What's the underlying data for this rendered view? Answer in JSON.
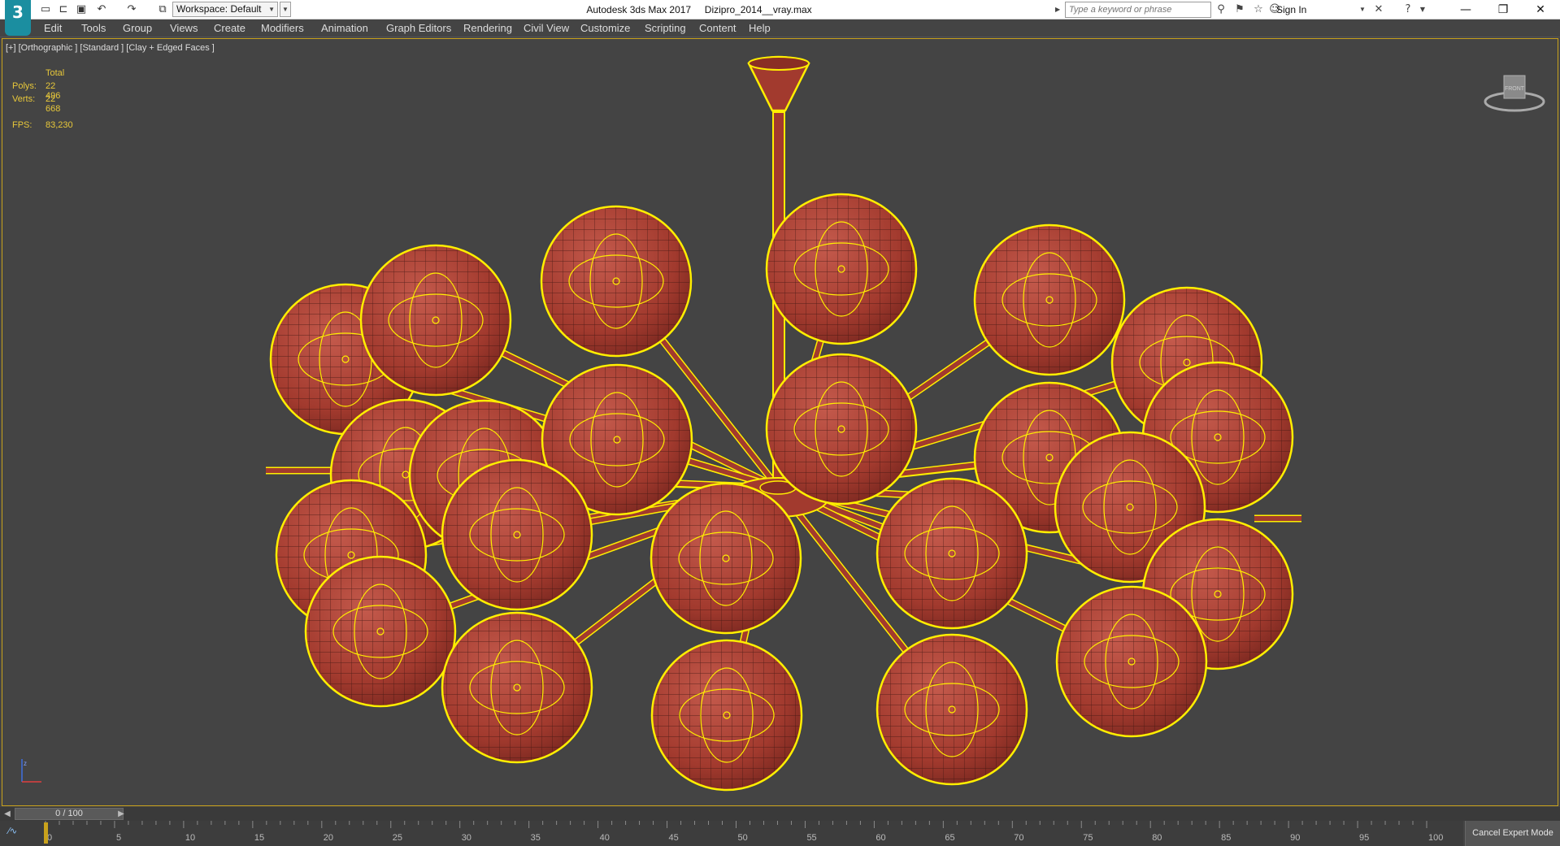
{
  "window": {
    "title": "Autodesk 3ds Max 2017     Dizipro_2014__vray.max",
    "app_logo": "3"
  },
  "quick_access": {
    "icons": [
      "new-file-icon",
      "open-file-icon",
      "save-icon",
      "undo-icon",
      "redo-icon",
      "project-folder-icon"
    ],
    "workspace_label": "Workspace: Default"
  },
  "search": {
    "placeholder": "Type a keyword or phrase"
  },
  "signin": {
    "label": "Sign In"
  },
  "menu": {
    "items": [
      "Edit",
      "Tools",
      "Group",
      "Views",
      "Create",
      "Modifiers",
      "Animation",
      "Graph Editors",
      "Rendering",
      "Civil View",
      "Customize",
      "Scripting",
      "Content",
      "Help"
    ]
  },
  "viewport": {
    "label": "[+] [Orthographic ] [Standard ] [Clay + Edged Faces ]",
    "stats": {
      "header": "Total",
      "polys_label": "Polys:",
      "polys_value": "22 496",
      "verts_label": "Verts:",
      "verts_value": "22 668",
      "fps_label": "FPS:",
      "fps_value": "83,230"
    },
    "viewcube_label": "FRONT"
  },
  "time_slider": {
    "value": "0 / 100",
    "current_frame": 0,
    "total_frames": 100
  },
  "trackbar": {
    "ticks": [
      "0",
      "5",
      "10",
      "15",
      "20",
      "25",
      "30",
      "35",
      "40",
      "45",
      "50",
      "55",
      "60",
      "65",
      "70",
      "75",
      "80",
      "85",
      "90",
      "95",
      "100"
    ]
  },
  "status": {
    "cancel_expert_label": "Cancel Expert Mode"
  },
  "colors": {
    "selection": "#ffee00",
    "clay": "#a23a2e",
    "viewport_bg": "#444444",
    "stats_text": "#e8c83a"
  }
}
